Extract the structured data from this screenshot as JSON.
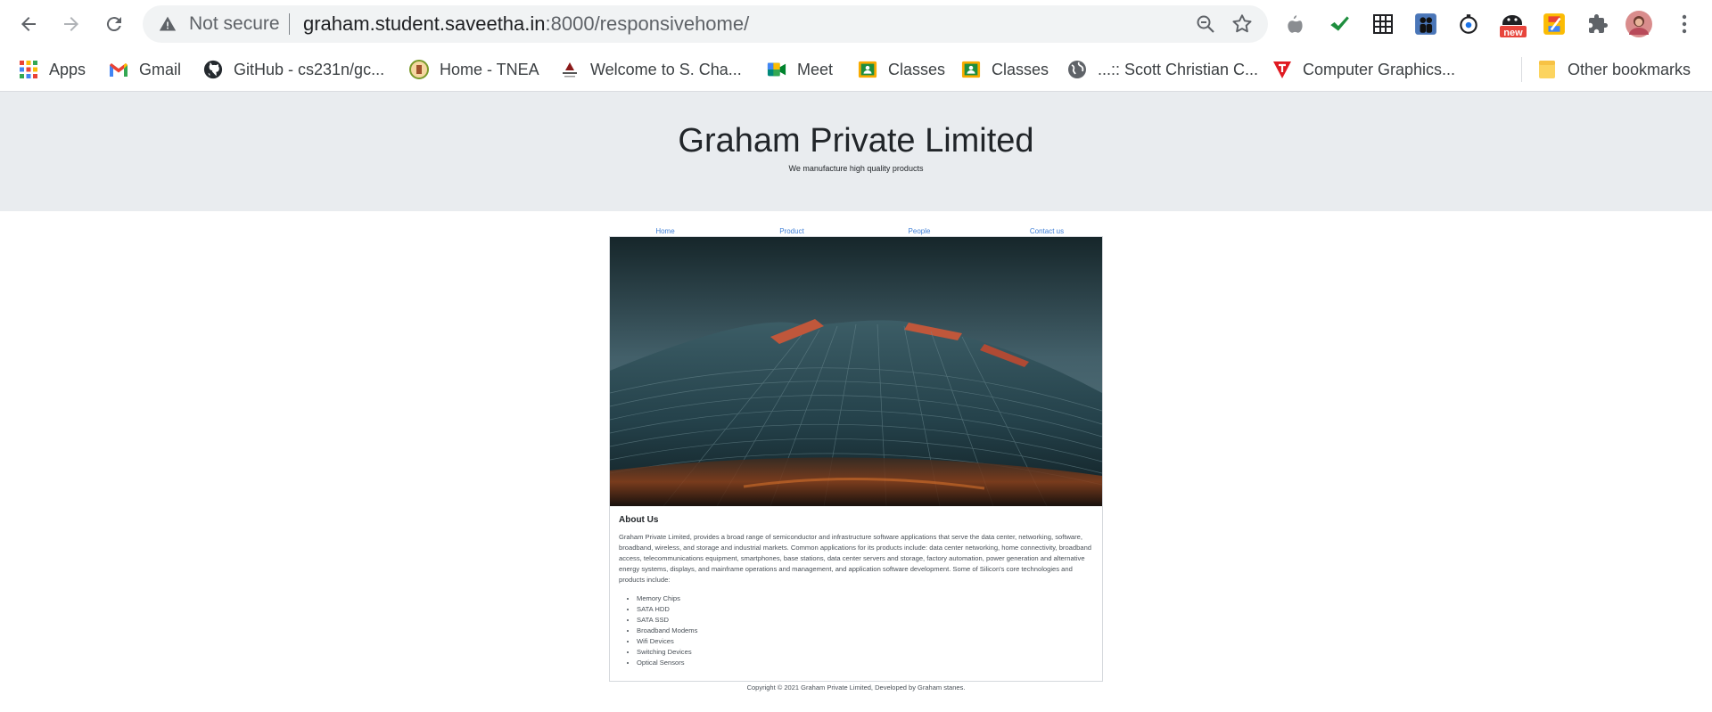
{
  "browser": {
    "security_label": "Not secure",
    "url_host": "graham.student.saveetha.in",
    "url_rest": ":8000/responsivehome/",
    "extensions": [
      "apple-icon",
      "checkmark-icon",
      "grid-icon",
      "people-icon",
      "timer-icon",
      "new-badge-icon",
      "puzzle-icon",
      "profile-avatar"
    ],
    "extension_badge": "new"
  },
  "bookmarks": [
    {
      "label": "Apps",
      "icon": "apps-grid-icon"
    },
    {
      "label": "Gmail",
      "icon": "gmail-icon"
    },
    {
      "label": "GitHub - cs231n/gc...",
      "icon": "github-icon"
    },
    {
      "label": "Home - TNEA",
      "icon": "tnea-emblem-icon"
    },
    {
      "label": "Welcome to S. Cha...",
      "icon": "college-logo-icon"
    },
    {
      "label": "Meet",
      "icon": "meet-icon"
    },
    {
      "label": "Classes",
      "icon": "classroom-icon"
    },
    {
      "label": "Classes",
      "icon": "classroom-icon"
    },
    {
      "label": "...:: Scott Christian C...",
      "icon": "globe-icon"
    },
    {
      "label": "Computer Graphics...",
      "icon": "tutorial-logo-icon"
    }
  ],
  "other_bookmarks": "Other bookmarks",
  "page": {
    "title": "Graham Private Limited",
    "tagline": "We manufacture high quality products",
    "nav": [
      "Home",
      "Product",
      "People",
      "Contact us"
    ],
    "about_heading": "About Us",
    "about_text": "Graham Private Limited, provides a broad range of semiconductor and infrastructure software applications that serve the data center, networking, software, broadband, wireless, and storage and industrial markets. Common applications for its products include: data center networking, home connectivity, broadband access, telecommunications equipment, smartphones, base stations, data center servers and storage, factory automation, power generation and alternative energy systems, displays, and mainframe operations and management, and application software development. Some of Silicon's core technologies and products include:",
    "products": [
      "Memory Chips",
      "SATA HDD",
      "SATA SSD",
      "Broadband Modems",
      "Wifi Devices",
      "Switching Devices",
      "Optical Sensors"
    ],
    "footer": "Copyright © 2021 Graham Private Limited, Developed by Graham stanes."
  },
  "colors": {
    "hero_bg": "#e9ecef",
    "link": "#3f7fd6",
    "omnibox_bg": "#f1f3f4"
  }
}
